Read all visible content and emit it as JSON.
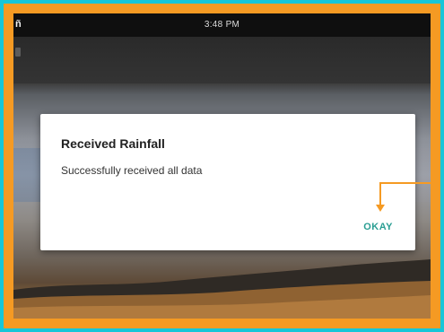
{
  "status_bar": {
    "time": "3:48 PM",
    "left_icon": "notification-icon"
  },
  "dialog": {
    "title": "Received Rainfall",
    "message": "Successfully received all data",
    "button_label": "OKAY"
  },
  "colors": {
    "border": "#f59a23",
    "outer": "#17c6d8",
    "accent": "#2a9e93"
  }
}
